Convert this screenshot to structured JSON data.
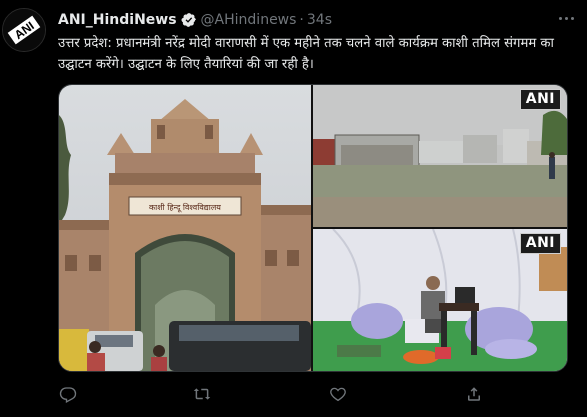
{
  "tweet": {
    "display_name": "ANI_HindiNews",
    "handle": "@AHindinews",
    "separator": "·",
    "time": "34s",
    "avatar_logo_text": "ANI",
    "text": "उत्तर प्रदेश: प्रधानमंत्री नरेंद्र मोदी वाराणसी में एक महीने तक चलने वाले कार्यक्रम काशी तमिल संगमम का उद्घाटन करेंगे। उद्घाटन के लिए तैयारियां की जा रही है।"
  },
  "media": {
    "photo1": {
      "gate_sign": "काशी हिन्दू विश्वविद्यालय"
    },
    "photo2": {
      "watermark": "ANI"
    },
    "photo3": {
      "watermark": "ANI"
    }
  },
  "actions": {
    "icons": [
      "reply-icon",
      "retweet-icon",
      "like-icon",
      "share-icon"
    ]
  },
  "colors": {
    "background": "#000000",
    "text": "#e7e9ea",
    "muted": "#71767b",
    "verified": "#e7e9ea"
  }
}
